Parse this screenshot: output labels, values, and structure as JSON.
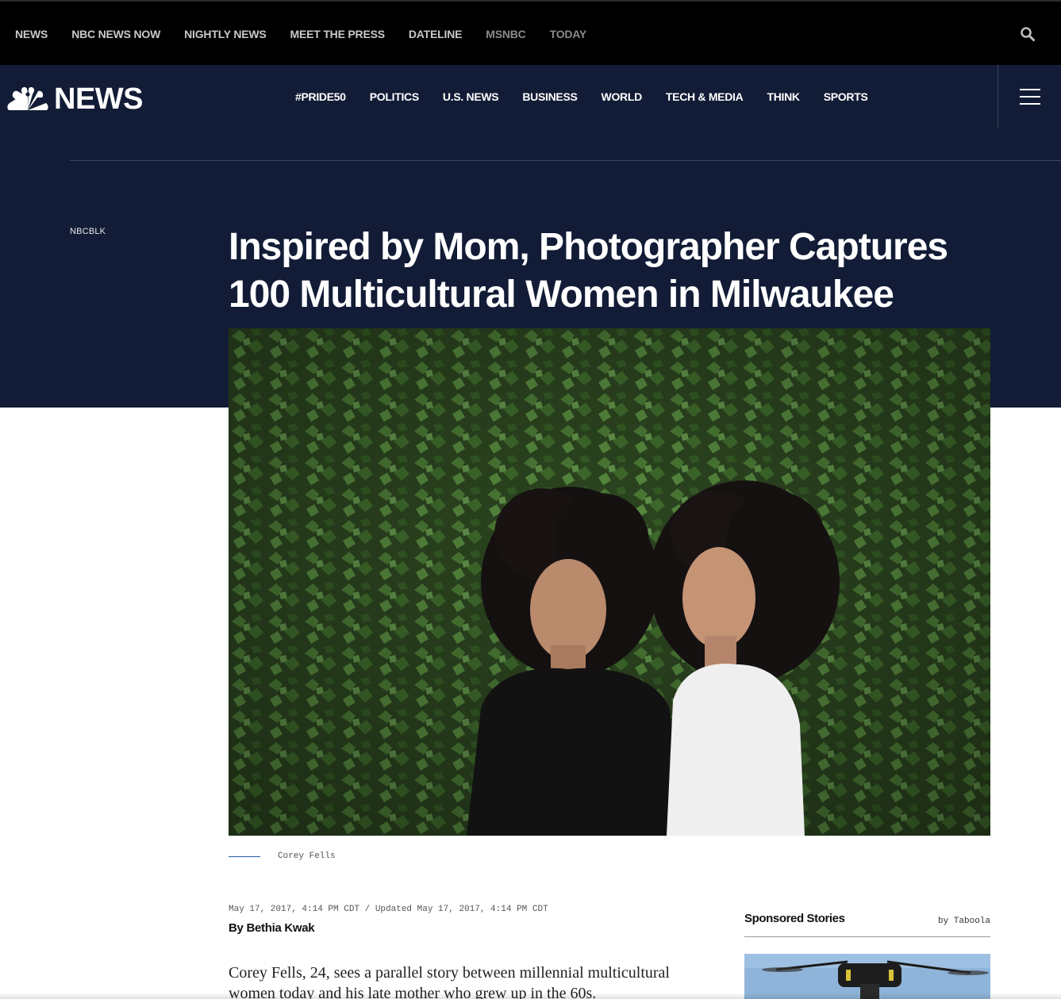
{
  "topbar": {
    "items": [
      "NEWS",
      "NBC NEWS NOW",
      "NIGHTLY NEWS",
      "MEET THE PRESS",
      "DATELINE",
      "MSNBC",
      "TODAY"
    ]
  },
  "header": {
    "logo_text": "NEWS",
    "nav": [
      "#PRIDE50",
      "POLITICS",
      "U.S. NEWS",
      "BUSINESS",
      "WORLD",
      "TECH & MEDIA",
      "THINK",
      "SPORTS"
    ]
  },
  "article": {
    "section": "NBCBLK",
    "headline": "Inspired by Mom, Photographer Captures 100 Multicultural Women in Milwaukee",
    "photo_credit": "Corey Fells",
    "dateline": "May 17, 2017, 4:14 PM CDT / Updated May 17, 2017, 4:14 PM CDT",
    "byline": "By Bethia Kwak",
    "lede": "Corey Fells, 24, sees a parallel story between millennial multicultural women today and his late mother who grew up in the 60s."
  },
  "sponsored": {
    "title": "Sponsored Stories",
    "provider": "by Taboola"
  },
  "colors": {
    "header_bg": "#121c36",
    "topbar_bg": "#000000",
    "accent": "#2a5aa8"
  }
}
